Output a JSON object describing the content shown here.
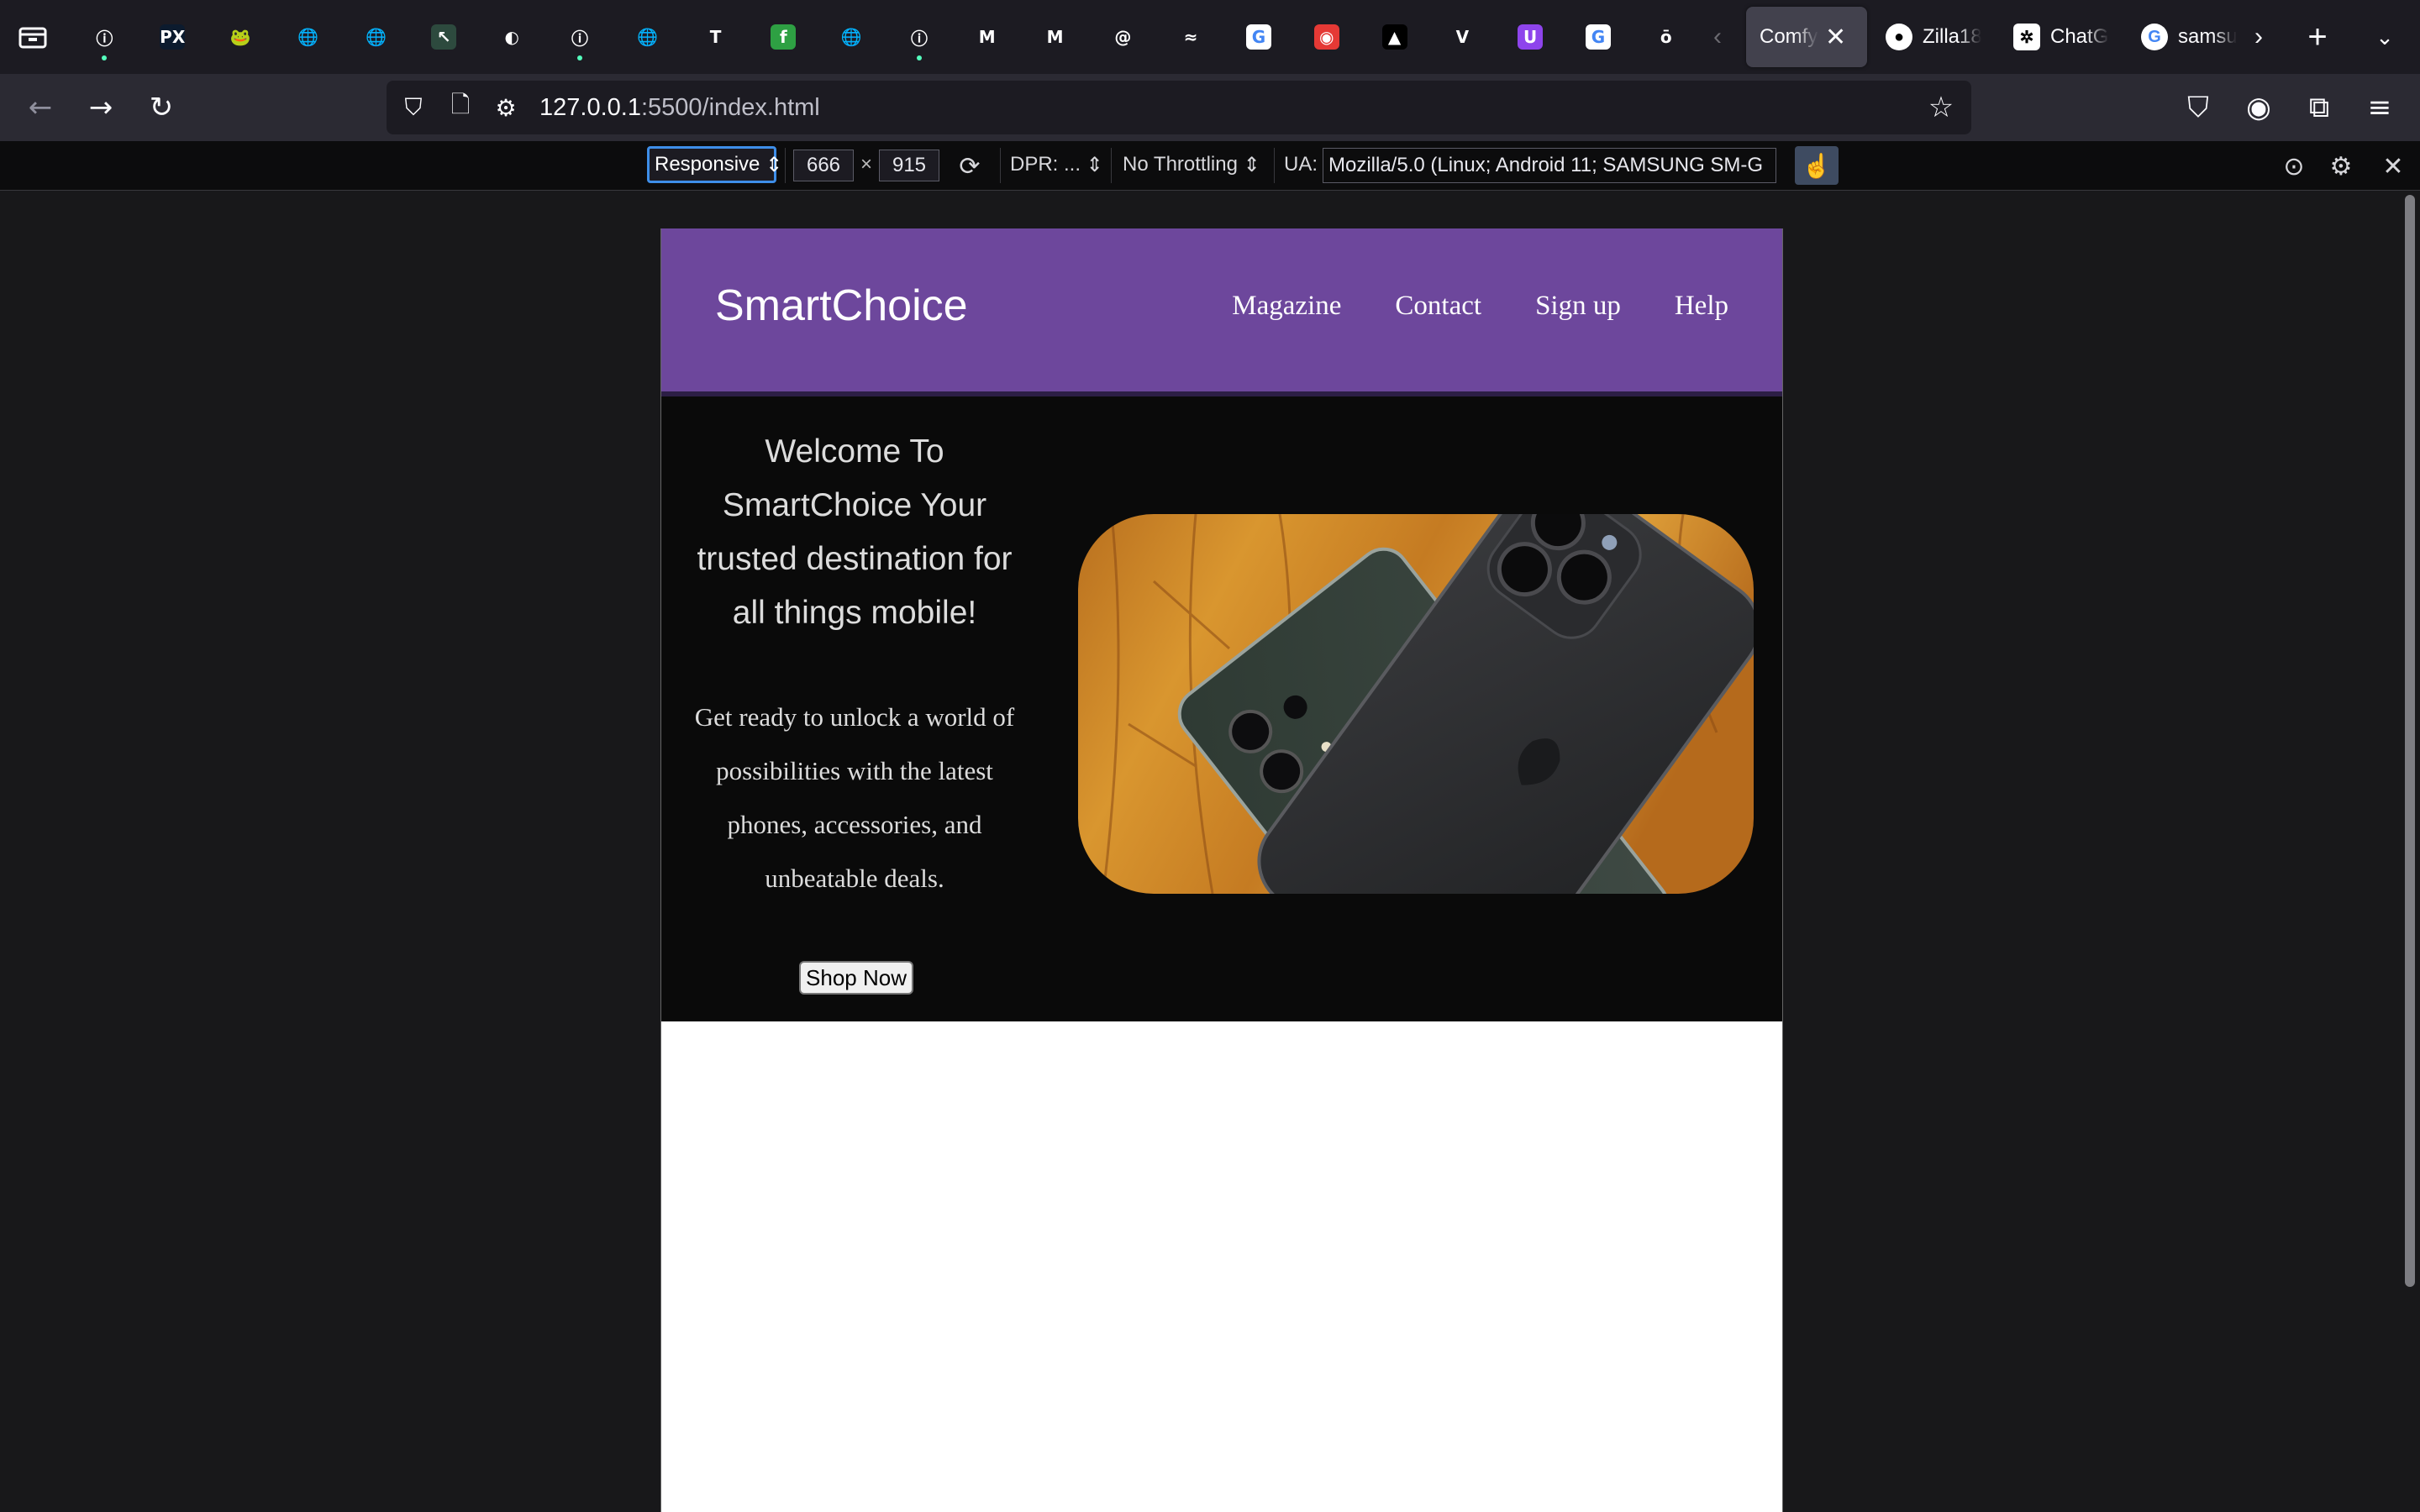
{
  "browser": {
    "pinned_tabs": [
      {
        "icon": "info-icon",
        "glyph": "ⓘ",
        "bg": "transparent",
        "dot": true
      },
      {
        "icon": "px-icon",
        "glyph": "PX",
        "bg": "#0c1b2e",
        "dot": false
      },
      {
        "icon": "frog-icon",
        "glyph": "🐸",
        "bg": "transparent",
        "dot": false
      },
      {
        "icon": "globe-icon",
        "glyph": "🌐",
        "bg": "transparent",
        "dot": false
      },
      {
        "icon": "globe-icon",
        "glyph": "🌐",
        "bg": "transparent",
        "dot": false
      },
      {
        "icon": "cursor-app-icon",
        "glyph": "↖",
        "bg": "#2d4a3e",
        "dot": false
      },
      {
        "icon": "blue-circle-icon",
        "glyph": "◐",
        "bg": "transparent",
        "dot": false
      },
      {
        "icon": "info-icon",
        "glyph": "ⓘ",
        "bg": "transparent",
        "dot": true
      },
      {
        "icon": "globe-icon",
        "glyph": "🌐",
        "bg": "transparent",
        "dot": false
      },
      {
        "icon": "t-icon",
        "glyph": "T",
        "bg": "transparent",
        "dot": false
      },
      {
        "icon": "green-f-icon",
        "glyph": "f",
        "bg": "#2ea043",
        "dot": false
      },
      {
        "icon": "globe-icon",
        "glyph": "🌐",
        "bg": "transparent",
        "dot": false
      },
      {
        "icon": "info-icon",
        "glyph": "ⓘ",
        "bg": "transparent",
        "dot": true
      },
      {
        "icon": "m-icon",
        "glyph": "M",
        "bg": "transparent",
        "dot": false
      },
      {
        "icon": "m-icon",
        "glyph": "M",
        "bg": "transparent",
        "dot": false
      },
      {
        "icon": "debian-icon",
        "glyph": "@",
        "bg": "transparent",
        "dot": false
      },
      {
        "icon": "tailwind-icon",
        "glyph": "≈",
        "bg": "transparent",
        "dot": false
      },
      {
        "icon": "google-icon",
        "glyph": "G",
        "bg": "#ffffff",
        "dot": false
      },
      {
        "icon": "red-app-icon",
        "glyph": "◉",
        "bg": "#e53935",
        "dot": false
      },
      {
        "icon": "vercel-icon",
        "glyph": "▲",
        "bg": "#000000",
        "dot": false
      },
      {
        "icon": "v-icon",
        "glyph": "V",
        "bg": "transparent",
        "dot": false
      },
      {
        "icon": "purple-app-icon",
        "glyph": "U",
        "bg": "#8e44ec",
        "dot": false
      },
      {
        "icon": "google-icon",
        "glyph": "G",
        "bg": "#ffffff",
        "dot": false
      },
      {
        "icon": "green-o-icon",
        "glyph": "ō",
        "bg": "transparent",
        "dot": false
      }
    ],
    "active_tab": {
      "label": "Comfy (",
      "icon": "none"
    },
    "tabs": [
      {
        "label": "Zilla18",
        "icon": "github-icon"
      },
      {
        "label": "ChatG",
        "icon": "chatgpt-icon"
      },
      {
        "label": "samsu",
        "icon": "google-icon"
      }
    ],
    "url_host": "127.0.0.1",
    "url_rest": ":5500/index.html"
  },
  "rdm": {
    "device": "Responsive",
    "width": "666",
    "height": "915",
    "dpr": "DPR: ...",
    "throttling": "No Throttling",
    "ua_label": "UA:",
    "ua_value": "Mozilla/5.0 (Linux; Android 11; SAMSUNG SM-G"
  },
  "site": {
    "brand": "SmartChoice",
    "nav": [
      "Magazine",
      "Contact",
      "Sign up",
      "Help"
    ],
    "hero_title": "Welcome To SmartChoice Your trusted destination for all things mobile!",
    "hero_text": "Get ready to unlock a world of possibilities with the latest phones, accessories, and unbeatable deals.",
    "cta": "Shop Now",
    "colors": {
      "header": "#6d479c",
      "hero_bg": "#0a0a0a",
      "text": "#dcdcdc"
    }
  }
}
